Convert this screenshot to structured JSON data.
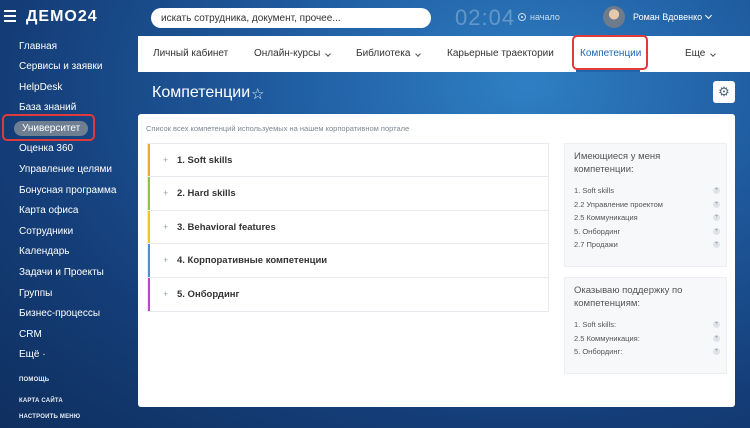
{
  "header": {
    "logo": "ДЕМО24",
    "search_placeholder": "искать сотрудника, документ, прочее...",
    "clock": "02:04",
    "status": "начало",
    "user_name": "Роман Вдовенко"
  },
  "sidebar": {
    "items": [
      {
        "label": "Главная"
      },
      {
        "label": "Сервисы и заявки"
      },
      {
        "label": "HelpDesk"
      },
      {
        "label": "База знаний"
      },
      {
        "label": "Университет",
        "active": true
      },
      {
        "label": "Оценка 360"
      },
      {
        "label": "Управление целями"
      },
      {
        "label": "Бонусная программа"
      },
      {
        "label": "Карта офиса"
      },
      {
        "label": "Сотрудники"
      },
      {
        "label": "Календарь"
      },
      {
        "label": "Задачи и Проекты"
      },
      {
        "label": "Группы"
      },
      {
        "label": "Бизнес-процессы"
      },
      {
        "label": "CRM"
      },
      {
        "label": "Ещё ·"
      }
    ],
    "footer": [
      "ПОМОЩЬ",
      "КАРТА САЙТА",
      "НАСТРОИТЬ МЕНЮ"
    ]
  },
  "topmenu": {
    "items": [
      {
        "label": "Личный кабинет"
      },
      {
        "label": "Онлайн-курсы"
      },
      {
        "label": "Библиотека"
      },
      {
        "label": "Карьерные траектории"
      },
      {
        "label": "Компетенции"
      },
      {
        "label": "Еще"
      }
    ]
  },
  "page": {
    "title": "Компетенции",
    "description": "Список всех компетенций используемых на нашем корпоративном портале"
  },
  "competencies": [
    {
      "label": "1. Soft skills",
      "color": "#f0a830"
    },
    {
      "label": "2. Hard skills",
      "color": "#8cc63f"
    },
    {
      "label": "3. Behavioral features",
      "color": "#f3c623"
    },
    {
      "label": "4. Корпоративные компетенции",
      "color": "#4a90d9"
    },
    {
      "label": "5. Онбординг",
      "color": "#c43fd6"
    }
  ],
  "my_competencies": {
    "title": "Имеющиеся у меня компетенции:",
    "items": [
      "1. Soft skills",
      "2.2 Управление проектом",
      "2.5 Коммуникация",
      "5. Онбординг",
      "2.7 Продажи"
    ]
  },
  "support_competencies": {
    "title": "Оказываю поддержку по компетенциям:",
    "items": [
      "1. Soft skills:",
      "2.5 Коммуникация:",
      "5. Онбординг:"
    ]
  },
  "colors": {
    "accent": "#2067b0",
    "highlight": "#e03a3a"
  }
}
